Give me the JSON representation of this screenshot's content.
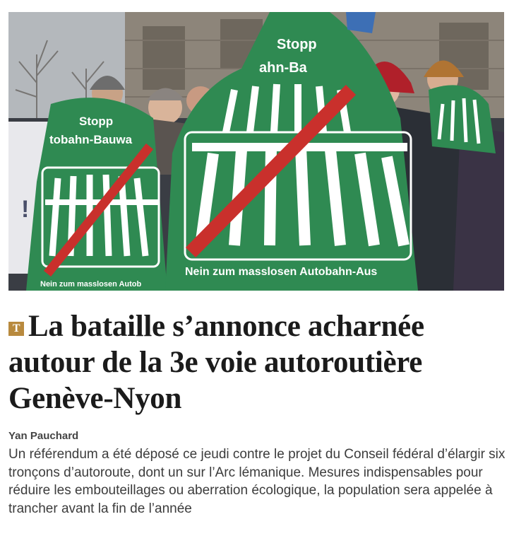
{
  "article": {
    "image": {
      "sign_top_left": "Stopp",
      "sign_top_right": "Stopp",
      "banner_line_left": "tobahn-Bauwa",
      "banner_line_right": "ahn-Ba",
      "bottom_text_left": "Nein zum masslosen Autob",
      "bottom_text_right": "Nein zum masslosen Autobahn-Aus",
      "back_banner_fragment": "!"
    },
    "badge": "T",
    "headline": "La bataille s’annonce acharnée autour de la 3e voie autoroutière Genève-Nyon",
    "author": "Yan Pauchard",
    "lead": "Un référendum a été déposé ce jeudi contre le projet du Conseil fédéral d’élargir six tronçons d’autoroute, dont un sur l’Arc lémanique. Mesures indispensables pour réduire les embouteillages ou aberration écologique, la population sera appelée à trancher avant la fin de l’année"
  },
  "colors": {
    "flag_green": "#2f8a52",
    "slash_red": "#c9302c",
    "badge_gold": "#b88a3e"
  }
}
